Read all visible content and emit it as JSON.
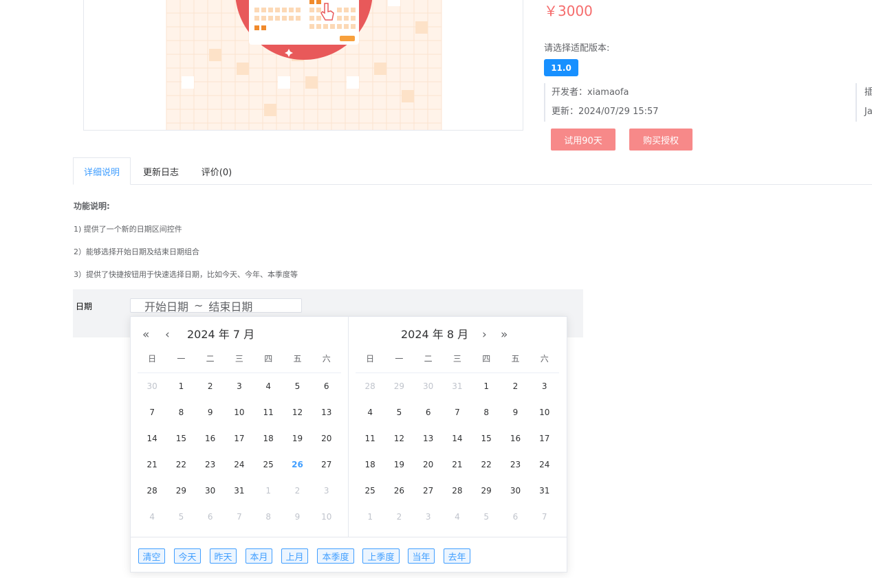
{
  "product": {
    "price": "￥3000",
    "version_label": "请选择适配版本:",
    "version": "11.0",
    "developer_label": "开发者：",
    "developer": "xiamaofa",
    "updated_label": "更新：",
    "updated": "2024/07/29 15:57",
    "right_meta_1": "插",
    "right_meta_2": "Ja",
    "trial_button": "试用90天",
    "buy_button": "购买授权"
  },
  "tabs": [
    {
      "label": "详细说明",
      "active": true
    },
    {
      "label": "更新日志",
      "active": false
    },
    {
      "label": "评价(0)",
      "active": false
    }
  ],
  "description": {
    "title": "功能说明:",
    "lines": [
      "1) 提供了一个新的日期区间控件",
      "2）能够选择开始日期及结束日期组合",
      "3）提供了快捷按钮用于快速选择日期，比如今天、今年、本季度等"
    ]
  },
  "form": {
    "label": "日期",
    "start_placeholder": "开始日期",
    "separator": "~",
    "end_placeholder": "结束日期"
  },
  "picker": {
    "weekdays": [
      "日",
      "一",
      "二",
      "三",
      "四",
      "五",
      "六"
    ],
    "left": {
      "title": "2024 年  7 月",
      "days": [
        {
          "d": "30",
          "o": true
        },
        {
          "d": "1"
        },
        {
          "d": "2"
        },
        {
          "d": "3"
        },
        {
          "d": "4"
        },
        {
          "d": "5"
        },
        {
          "d": "6"
        },
        {
          "d": "7"
        },
        {
          "d": "8"
        },
        {
          "d": "9"
        },
        {
          "d": "10"
        },
        {
          "d": "11"
        },
        {
          "d": "12"
        },
        {
          "d": "13"
        },
        {
          "d": "14"
        },
        {
          "d": "15"
        },
        {
          "d": "16"
        },
        {
          "d": "17"
        },
        {
          "d": "18"
        },
        {
          "d": "19"
        },
        {
          "d": "20"
        },
        {
          "d": "21"
        },
        {
          "d": "22"
        },
        {
          "d": "23"
        },
        {
          "d": "24"
        },
        {
          "d": "25"
        },
        {
          "d": "26",
          "t": true
        },
        {
          "d": "27"
        },
        {
          "d": "28"
        },
        {
          "d": "29"
        },
        {
          "d": "30"
        },
        {
          "d": "31"
        },
        {
          "d": "1",
          "o": true
        },
        {
          "d": "2",
          "o": true
        },
        {
          "d": "3",
          "o": true
        },
        {
          "d": "4",
          "o": true
        },
        {
          "d": "5",
          "o": true
        },
        {
          "d": "6",
          "o": true
        },
        {
          "d": "7",
          "o": true
        },
        {
          "d": "8",
          "o": true
        },
        {
          "d": "9",
          "o": true
        },
        {
          "d": "10",
          "o": true
        }
      ]
    },
    "right": {
      "title": "2024 年  8 月",
      "days": [
        {
          "d": "28",
          "o": true
        },
        {
          "d": "29",
          "o": true
        },
        {
          "d": "30",
          "o": true
        },
        {
          "d": "31",
          "o": true
        },
        {
          "d": "1"
        },
        {
          "d": "2"
        },
        {
          "d": "3"
        },
        {
          "d": "4"
        },
        {
          "d": "5"
        },
        {
          "d": "6"
        },
        {
          "d": "7"
        },
        {
          "d": "8"
        },
        {
          "d": "9"
        },
        {
          "d": "10"
        },
        {
          "d": "11"
        },
        {
          "d": "12"
        },
        {
          "d": "13"
        },
        {
          "d": "14"
        },
        {
          "d": "15"
        },
        {
          "d": "16"
        },
        {
          "d": "17"
        },
        {
          "d": "18"
        },
        {
          "d": "19"
        },
        {
          "d": "20"
        },
        {
          "d": "21"
        },
        {
          "d": "22"
        },
        {
          "d": "23"
        },
        {
          "d": "24"
        },
        {
          "d": "25"
        },
        {
          "d": "26"
        },
        {
          "d": "27"
        },
        {
          "d": "28"
        },
        {
          "d": "29"
        },
        {
          "d": "30"
        },
        {
          "d": "31"
        },
        {
          "d": "1",
          "o": true
        },
        {
          "d": "2",
          "o": true
        },
        {
          "d": "3",
          "o": true
        },
        {
          "d": "4",
          "o": true
        },
        {
          "d": "5",
          "o": true
        },
        {
          "d": "6",
          "o": true
        },
        {
          "d": "7",
          "o": true
        }
      ]
    },
    "shortcuts": [
      "清空",
      "今天",
      "昨天",
      "本月",
      "上月",
      "本季度",
      "上季度",
      "当年",
      "去年"
    ]
  },
  "icons": {
    "double_left": "«",
    "left": "‹",
    "right": "›",
    "double_right": "»"
  },
  "colors": {
    "accent": "#409eff",
    "price": "#f56c6c",
    "button_red": "#f78989",
    "version_tag": "#1890ff"
  }
}
